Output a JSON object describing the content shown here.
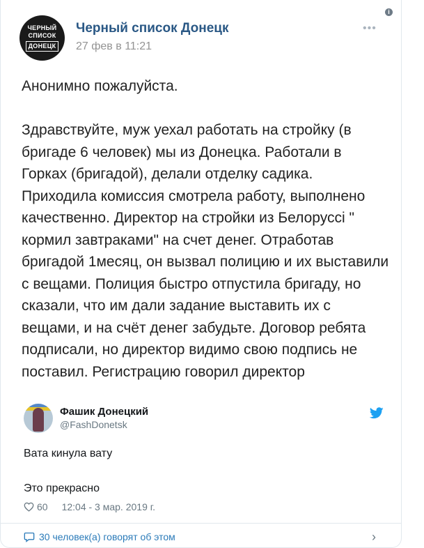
{
  "vk_post": {
    "avatar_line1": "ЧЕРНЫЙ",
    "avatar_line2": "СПИСОК",
    "avatar_line3": "ДОНЕЦК",
    "author": "Черный список Донецк",
    "date": "27 фев в 11:21",
    "paragraph1": "Анонимно пожалуйста.",
    "paragraph2": "Здравствуйте, муж уехал работать на стройку (в бригаде 6 человек) мы из Донецка. Работали в Горках (бригадой), делали отделку садика. Приходила комиссия смотрела работу, выполнено качественно. Директор на стройки из Белоруссі \" кормил завтраками\" на счет денег. Отработав бригадой 1месяц, он вызвал полицию и их выставили с вещами. Полиция быстро отпустила бригаду, но сказали, что им дали задание выставить их с вещами, и на счёт денег забудьте. Договор ребята подписали, но директор видимо свою подпись не поставил. Регистрацию говорил директор"
  },
  "tweet": {
    "name": "Фашик Донецкий",
    "handle": "@FashDonetsk",
    "line1": "Вата кинула вату",
    "line2": "Это прекрасно",
    "likes": "60",
    "timestamp": "12:04 - 3 мар. 2019 г.",
    "talking": "30 человек(а) говорят об этом"
  },
  "colors": {
    "vk_link": "#2a5885",
    "twitter_blue": "#1da1f2",
    "twitter_link": "#2b7bb9",
    "meta_gray": "#697882"
  },
  "icons": [
    "info-icon",
    "more-icon",
    "twitter-bird-icon",
    "heart-icon",
    "comment-icon",
    "chevron-right-icon"
  ]
}
